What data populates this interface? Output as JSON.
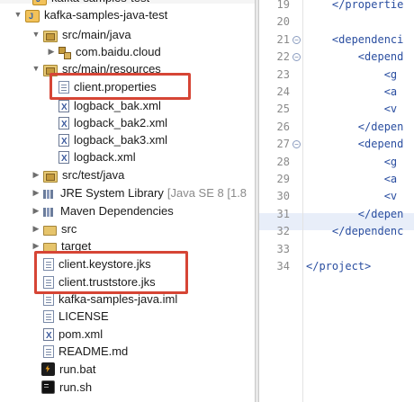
{
  "tree": {
    "top_clipped_label": "kafka-samples-test",
    "project": "kafka-samples-java-test",
    "src_main_java": "src/main/java",
    "package": "com.baidu.cloud",
    "src_main_resources": "src/main/resources",
    "client_properties": "client.properties",
    "logback_bak": "logback_bak.xml",
    "logback_bak2": "logback_bak2.xml",
    "logback_bak3": "logback_bak3.xml",
    "logback": "logback.xml",
    "src_test_java": "src/test/java",
    "jre_library": "JRE System Library",
    "jre_version": "[Java SE 8 [1.8",
    "maven_deps": "Maven Dependencies",
    "src": "src",
    "target": "target",
    "keystore": "client.keystore.jks",
    "truststore": "client.truststore.jks",
    "iml": "kafka-samples-java.iml",
    "license": "LICENSE",
    "pom": "pom.xml",
    "readme": "README.md",
    "run_bat": "run.bat",
    "run_sh": "run.sh"
  },
  "editor": {
    "lines": [
      {
        "n": "19",
        "fold": false,
        "indent": "    ",
        "text": "</propertie"
      },
      {
        "n": "20",
        "fold": false,
        "indent": "",
        "text": ""
      },
      {
        "n": "21",
        "fold": true,
        "indent": "    ",
        "text": "<dependenci"
      },
      {
        "n": "22",
        "fold": true,
        "indent": "        ",
        "text": "<depend"
      },
      {
        "n": "23",
        "fold": false,
        "indent": "            ",
        "text": "<g"
      },
      {
        "n": "24",
        "fold": false,
        "indent": "            ",
        "text": "<a"
      },
      {
        "n": "25",
        "fold": false,
        "indent": "            ",
        "text": "<v"
      },
      {
        "n": "26",
        "fold": false,
        "indent": "        ",
        "text": "</depen"
      },
      {
        "n": "27",
        "fold": true,
        "indent": "        ",
        "text": "<depend"
      },
      {
        "n": "28",
        "fold": false,
        "indent": "            ",
        "text": "<g"
      },
      {
        "n": "29",
        "fold": false,
        "indent": "            ",
        "text": "<a"
      },
      {
        "n": "30",
        "fold": false,
        "indent": "            ",
        "text": "<v"
      },
      {
        "n": "31",
        "fold": false,
        "indent": "        ",
        "text": "</depen"
      },
      {
        "n": "32",
        "fold": false,
        "indent": "    ",
        "text": "</dependenc"
      },
      {
        "n": "33",
        "fold": false,
        "indent": "",
        "text": ""
      },
      {
        "n": "34",
        "fold": false,
        "indent": "",
        "text": "</project>"
      }
    ]
  },
  "highlight_color": "#d64535"
}
